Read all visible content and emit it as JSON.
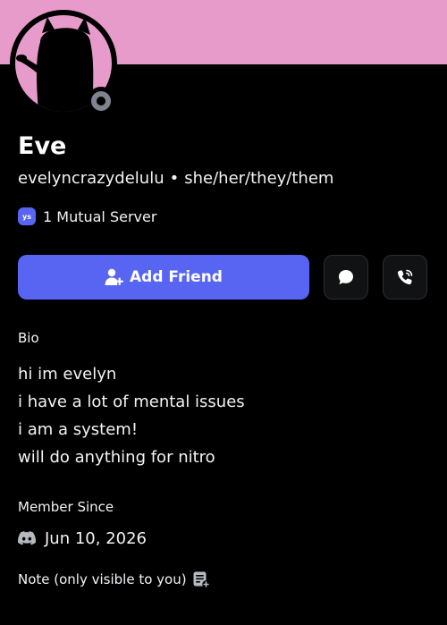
{
  "profile": {
    "display_name": "Eve",
    "username": "evelyncrazydelulu",
    "separator": "•",
    "pronouns": "she/her/they/them",
    "avatar_icon": "anime-girl-silhouette-avatar",
    "status": "offline"
  },
  "mutual": {
    "server_badge": "ys",
    "label": "1 Mutual Server"
  },
  "actions": {
    "add_friend_label": "Add Friend",
    "add_friend_icon": "person-add-icon",
    "message_icon": "chat-bubble-icon",
    "call_icon": "phone-icon"
  },
  "bio": {
    "heading": "Bio",
    "lines": [
      "hi im evelyn",
      "i have a lot of mental issues",
      "i am a system!",
      "will do anything for nitro"
    ]
  },
  "member_since": {
    "heading": "Member Since",
    "icon": "discord-logo-icon",
    "date": "Jun 10, 2026"
  },
  "note": {
    "label": "Note (only visible to you)",
    "icon": "edit-note-icon"
  },
  "colors": {
    "banner": "#e79bcb",
    "background": "#000000",
    "accent": "#5865f2",
    "status_offline": "#80848e"
  }
}
